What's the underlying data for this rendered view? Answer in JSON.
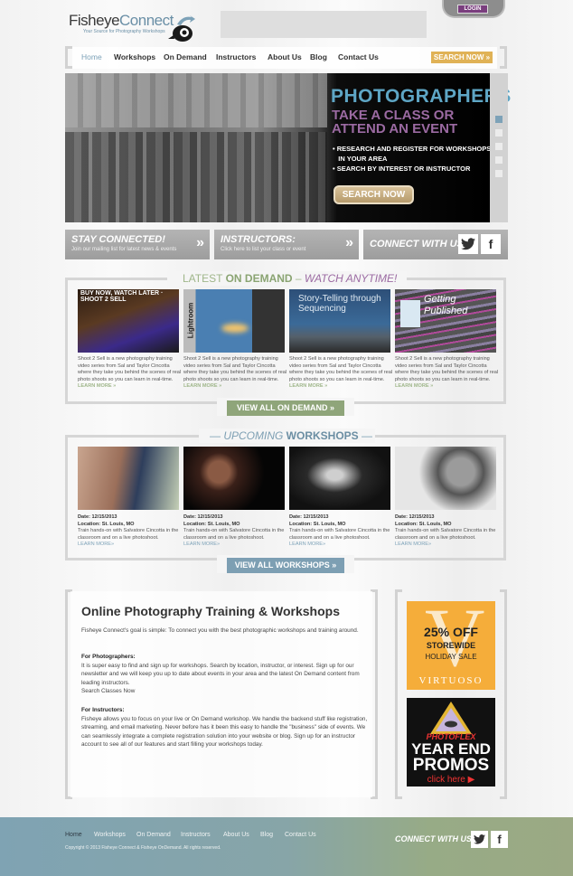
{
  "header": {
    "logo_part1": "Fisheye",
    "logo_part2": "Connect",
    "tagline": "Your Source for Photography Workshops",
    "login_label": "LOGIN"
  },
  "nav": {
    "items": [
      "Home",
      "Workshops",
      "On Demand",
      "Instructors",
      "About Us",
      "Blog",
      "Contact Us"
    ],
    "active": "Home",
    "search_now_label": "SEARCH NOW »"
  },
  "hero": {
    "title": "PHOTOGRAPHERS",
    "subtitle_line1": "TAKE A CLASS OR",
    "subtitle_line2": "ATTEND AN EVENT",
    "bullets": [
      "• RESEARCH AND REGISTER FOR WORKSHOPS",
      "   IN YOUR AREA",
      "• SEARCH BY INTEREST OR INSTRUCTOR"
    ],
    "button_label": "SEARCH NOW",
    "slide_count": 5,
    "active_slide": 1
  },
  "strip": {
    "stay_title": "STAY CONNECTED!",
    "stay_sub": "Join our mailing list for latest news & events",
    "instructors_title": "INSTRUCTORS:",
    "instructors_sub": "Click here to list your class or event",
    "connect_title": "CONNECT WITH US:",
    "chevron": "»",
    "twitter": "🐦",
    "facebook": "f"
  },
  "on_demand": {
    "title_a": "LATEST ",
    "title_b": "ON DEMAND",
    "title_c": " – ",
    "title_d": "WATCH ANYTIME!",
    "items": [
      {
        "image_caption": "BUY NOW, WATCH LATER · SHOOT 2 SELL",
        "desc": "Shoot 2 Sell is a new photography training video series from Sal and Taylor Cincotta where they take you behind the scenes of real photo shoots so you can learn in real-time.",
        "link": "LEARN MORE »"
      },
      {
        "image_caption": "Lightroom",
        "desc": "Shoot 2 Sell is a new photography training video series from Sal and Taylor Cincotta where they take you behind the scenes of real photo shoots so you can learn in real-time.",
        "link": "LEARN MORE »"
      },
      {
        "image_caption": "Story-Telling through Sequencing",
        "desc": "Shoot 2 Sell is a new photography training video series from Sal and Taylor Cincotta where they take you behind the scenes of real photo shoots so you can learn in real-time.",
        "link": "LEARN MORE »"
      },
      {
        "image_caption": "Getting Published",
        "desc": "Shoot 2 Sell is a new photography training video series from Sal and Taylor Cincotta where they take you behind the scenes of real photo shoots so you can learn in real-time.",
        "link": "LEARN MORE »"
      }
    ],
    "view_all_label": "VIEW ALL ON DEMAND »"
  },
  "workshops": {
    "title_a": "— ",
    "title_b": "UPCOMING",
    "title_c": " WORKSHOPS",
    "title_d": " —",
    "items": [
      {
        "date": "Date: 12/15/2013",
        "location": "Location: St. Louis, MO",
        "desc": "Train hands-on with Salvatore Cincotta in the classroom and on a live photoshoot.",
        "link": "LEARN MORE»"
      },
      {
        "date": "Date: 12/15/2013",
        "location": "Location: St. Louis, MO",
        "desc": "Train hands-on with Salvatore Cincotta in the classroom and on a live photoshoot.",
        "link": "LEARN MORE»"
      },
      {
        "date": "Date: 12/15/2013",
        "location": "Location: St. Louis, MO",
        "desc": "Train hands-on with Salvatore Cincotta in the classroom and on a live photoshoot.",
        "link": "LEARN MORE»"
      },
      {
        "date": "Date: 12/15/2013",
        "location": "Location: St. Louis, MO",
        "desc": "Train hands-on with Salvatore Cincotta in the classroom and on a live photoshoot.",
        "link": "LEARN MORE»"
      }
    ],
    "view_all_label": "VIEW ALL WORKSHOPS »"
  },
  "content": {
    "title": "Online Photography Training & Workshops",
    "intro": "Fisheye Connect's goal is simple:  To connect you with the best photographic workshops and training around.",
    "photographers_heading": "For Photographers:",
    "photographers_body": "It is super easy to find and sign up for workshops. Search by location, instructor, or interest. Sign up for our newsletter and we will keep you up to date about events in your area and the latest On Demand content from leading instructors.",
    "photographers_link": "Search Classes Now",
    "instructors_heading": "For Instructors:",
    "instructors_body": "Fisheye allows you to focus on your live or On Demand workshop. We handle the backend stuff like registration, streaming, and email marketing. Never before has it been this easy to handle the \"business\" side of events. We can seamlessly integrate a complete registration solution into your website or blog. Sign up for an instructor account to see all of our features and start filling your workshops today."
  },
  "ads": {
    "ad1": {
      "line1": "25% OFF",
      "line2": "STOREWIDE",
      "line3": "HOLIDAY SALE",
      "brand": "VIRTUOSO",
      "letter": "V"
    },
    "ad2": {
      "brand": "PHOTOFLEX",
      "line1": "YEAR END",
      "line2": "PROMOS",
      "cta": "click here"
    }
  },
  "footer": {
    "links": [
      "Home",
      "Workshops",
      "On Demand",
      "Instructors",
      "About Us",
      "Blog",
      "Contact Us"
    ],
    "active": "Home",
    "copyright": "Copyright © 2013 Fisheye Connect & Fisheye OnDemand.  All rights reserved.",
    "connect_label": "CONNECT WITH US:"
  },
  "colors": {
    "accent_blue": "#7da2b8",
    "accent_green": "#9fb68a",
    "accent_purple": "#9b6aa2",
    "accent_orange": "#e0b256",
    "login_purple": "#7a3e7e"
  }
}
